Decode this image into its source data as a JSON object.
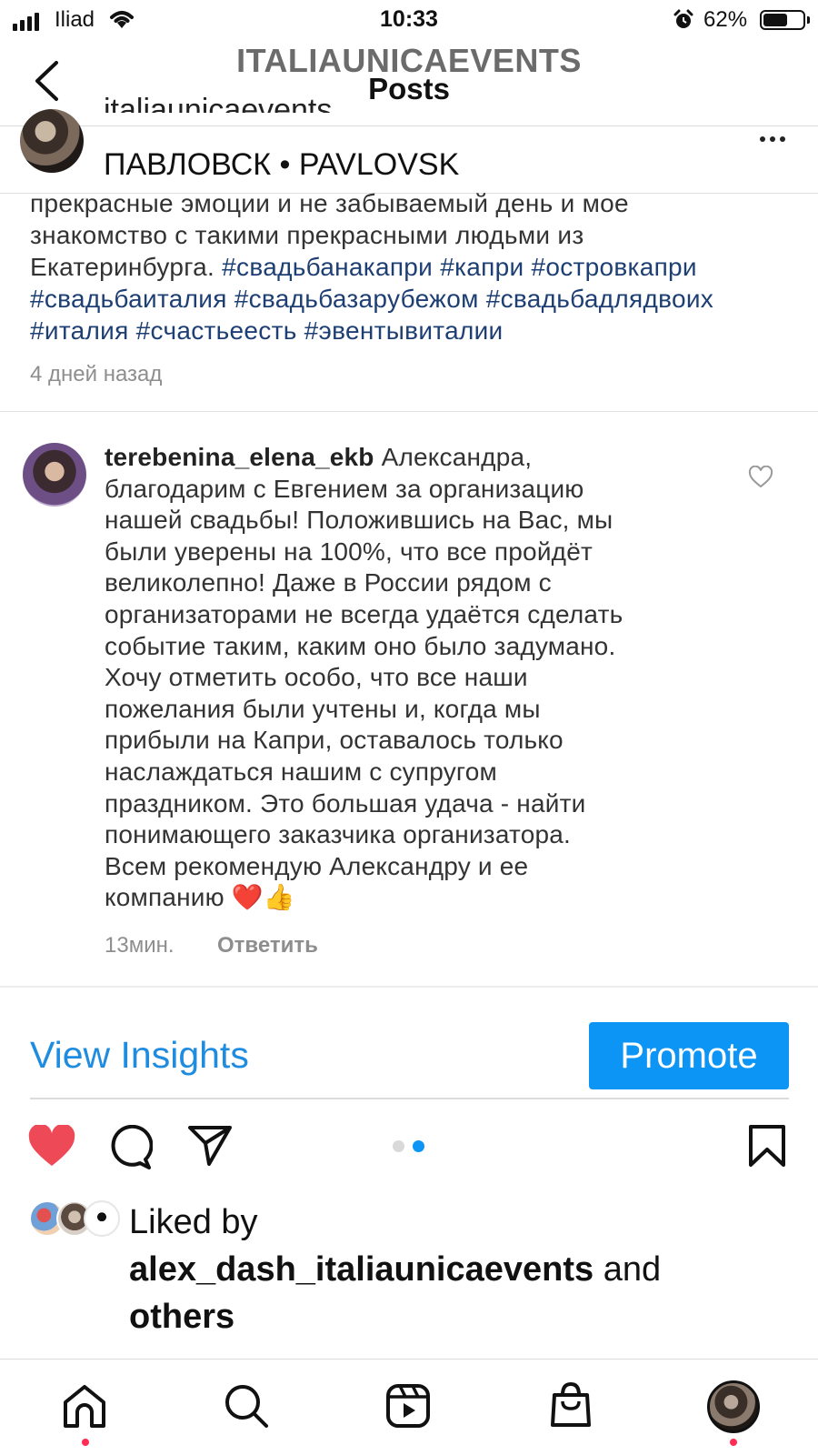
{
  "status_bar": {
    "carrier": "Iliad",
    "time": "10:33",
    "battery_percent": "62%",
    "battery_level": 0.62
  },
  "header": {
    "account": "ITALIAUNICAEVENTS",
    "title": "Posts"
  },
  "post": {
    "username": "italiaunicaevents",
    "location": "ПАВЛОВСК • PAVLOVSK",
    "caption_lines": [
      [
        {
          "text": "прекрасные эмоции и не забываемый день и мое"
        }
      ],
      [
        {
          "text": "знакомство с такими прекрасными людьми из"
        }
      ],
      [
        {
          "text": "Екатеринбурга.  "
        },
        {
          "text": "#свадьбанакапри #капри #островкапри",
          "tag": true
        }
      ],
      [
        {
          "text": "#свадьбаиталия #свадьбазарубежом #свадьбадлядвоих",
          "tag": true
        }
      ],
      [
        {
          "text": "#италия #счастьеесть #эвентывиталии",
          "tag": true
        }
      ]
    ],
    "time_ago": "4 дней назад"
  },
  "comment": {
    "username": "terebenina_elena_ekb",
    "lines": [
      " Александра,",
      "благодарим с Евгением за организацию",
      "нашей свадьбы! Положившись на Вас, мы",
      "были уверены на 100%, что все пройдёт",
      "великолепно! Даже в России рядом с",
      "организаторами не всегда удаётся сделать",
      "событие таким, каким оно было задумано.",
      "Хочу отметить особо, что все наши",
      "пожелания были учтены и, когда мы",
      "прибыли на Капри, оставалось только",
      "наслаждаться нашим с супругом",
      "праздником. Это большая удача - найти",
      "понимающего заказчика организатора.",
      "Всем рекомендую Александру и ее",
      "компанию ❤️👍"
    ],
    "time": "13мин.",
    "reply_label": "Ответить"
  },
  "actions": {
    "view_insights": "View Insights",
    "promote": "Promote",
    "carousel_count": 2,
    "carousel_active": 2
  },
  "likes": {
    "prefix": "Liked by",
    "user": "alex_dash_italiaunicaevents",
    "and": " and",
    "others": "others"
  },
  "colors": {
    "accent": "#0d95f6",
    "insights": "#1f8ce0",
    "like": "#ed4956",
    "hashtag": "#1e3f73"
  },
  "icons": [
    "signal-icon",
    "wifi-icon",
    "alarm-icon",
    "battery-icon",
    "back-icon",
    "more-icon",
    "heart-icon",
    "comment-icon",
    "share-icon",
    "save-icon",
    "home-icon",
    "search-icon",
    "reels-icon",
    "shop-icon"
  ]
}
